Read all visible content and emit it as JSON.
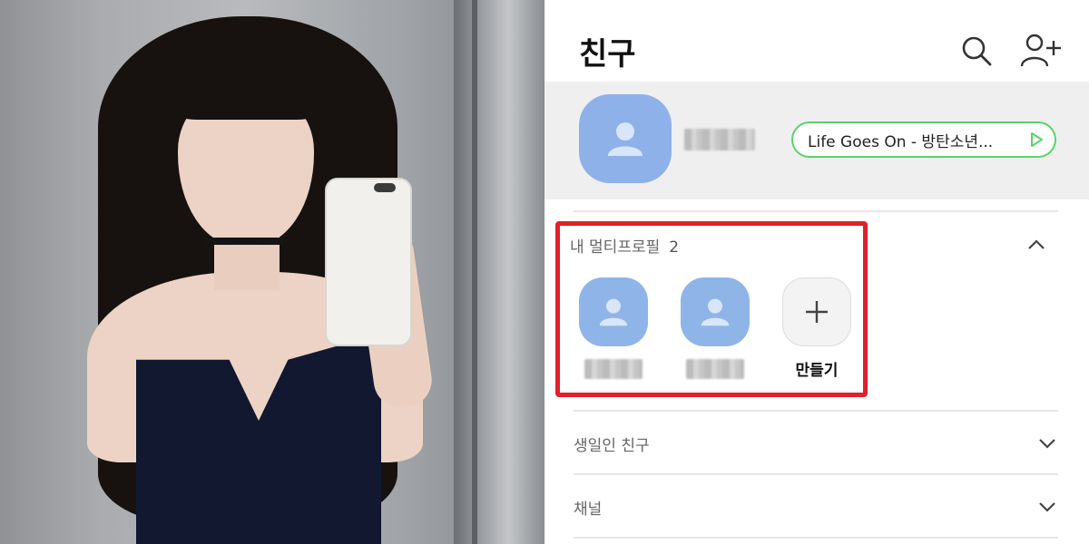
{
  "header": {
    "title": "친구"
  },
  "my_profile": {
    "music_status": "Life Goes On - 방탄소년..."
  },
  "multi_profile": {
    "label": "내 멀티프로필",
    "count": "2",
    "create_label": "만들기"
  },
  "sections": [
    {
      "label": "생일인 친구"
    },
    {
      "label": "채널"
    }
  ],
  "colors": {
    "highlight_border": "#e0202a",
    "music_border": "#59d26b",
    "avatar": "#8fb1ea"
  }
}
